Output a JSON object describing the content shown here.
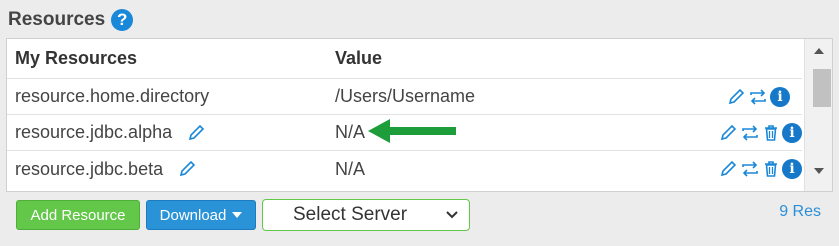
{
  "panel": {
    "title": "Resources"
  },
  "table": {
    "headers": {
      "name": "My Resources",
      "value": "Value"
    },
    "rows": [
      {
        "name": "resource.home.directory",
        "value": "/Users/Username",
        "editable_name": false,
        "deletable": false
      },
      {
        "name": "resource.jdbc.alpha",
        "value": "N/A",
        "editable_name": true,
        "deletable": true
      },
      {
        "name": "resource.jdbc.beta",
        "value": "N/A",
        "editable_name": true,
        "deletable": true
      }
    ]
  },
  "footer": {
    "add_label": "Add Resource",
    "download_label": "Download",
    "server_select": "Select Server",
    "count": "9 Res"
  },
  "colors": {
    "accent_blue": "#2a93d8",
    "accent_green": "#63c74a",
    "annotation_arrow": "#1e9e3a"
  },
  "icons": [
    "help-icon",
    "pencil-icon",
    "swap-icon",
    "trash-icon",
    "info-icon",
    "chevron-down-icon",
    "caret-down-icon",
    "arrow-left-icon"
  ]
}
